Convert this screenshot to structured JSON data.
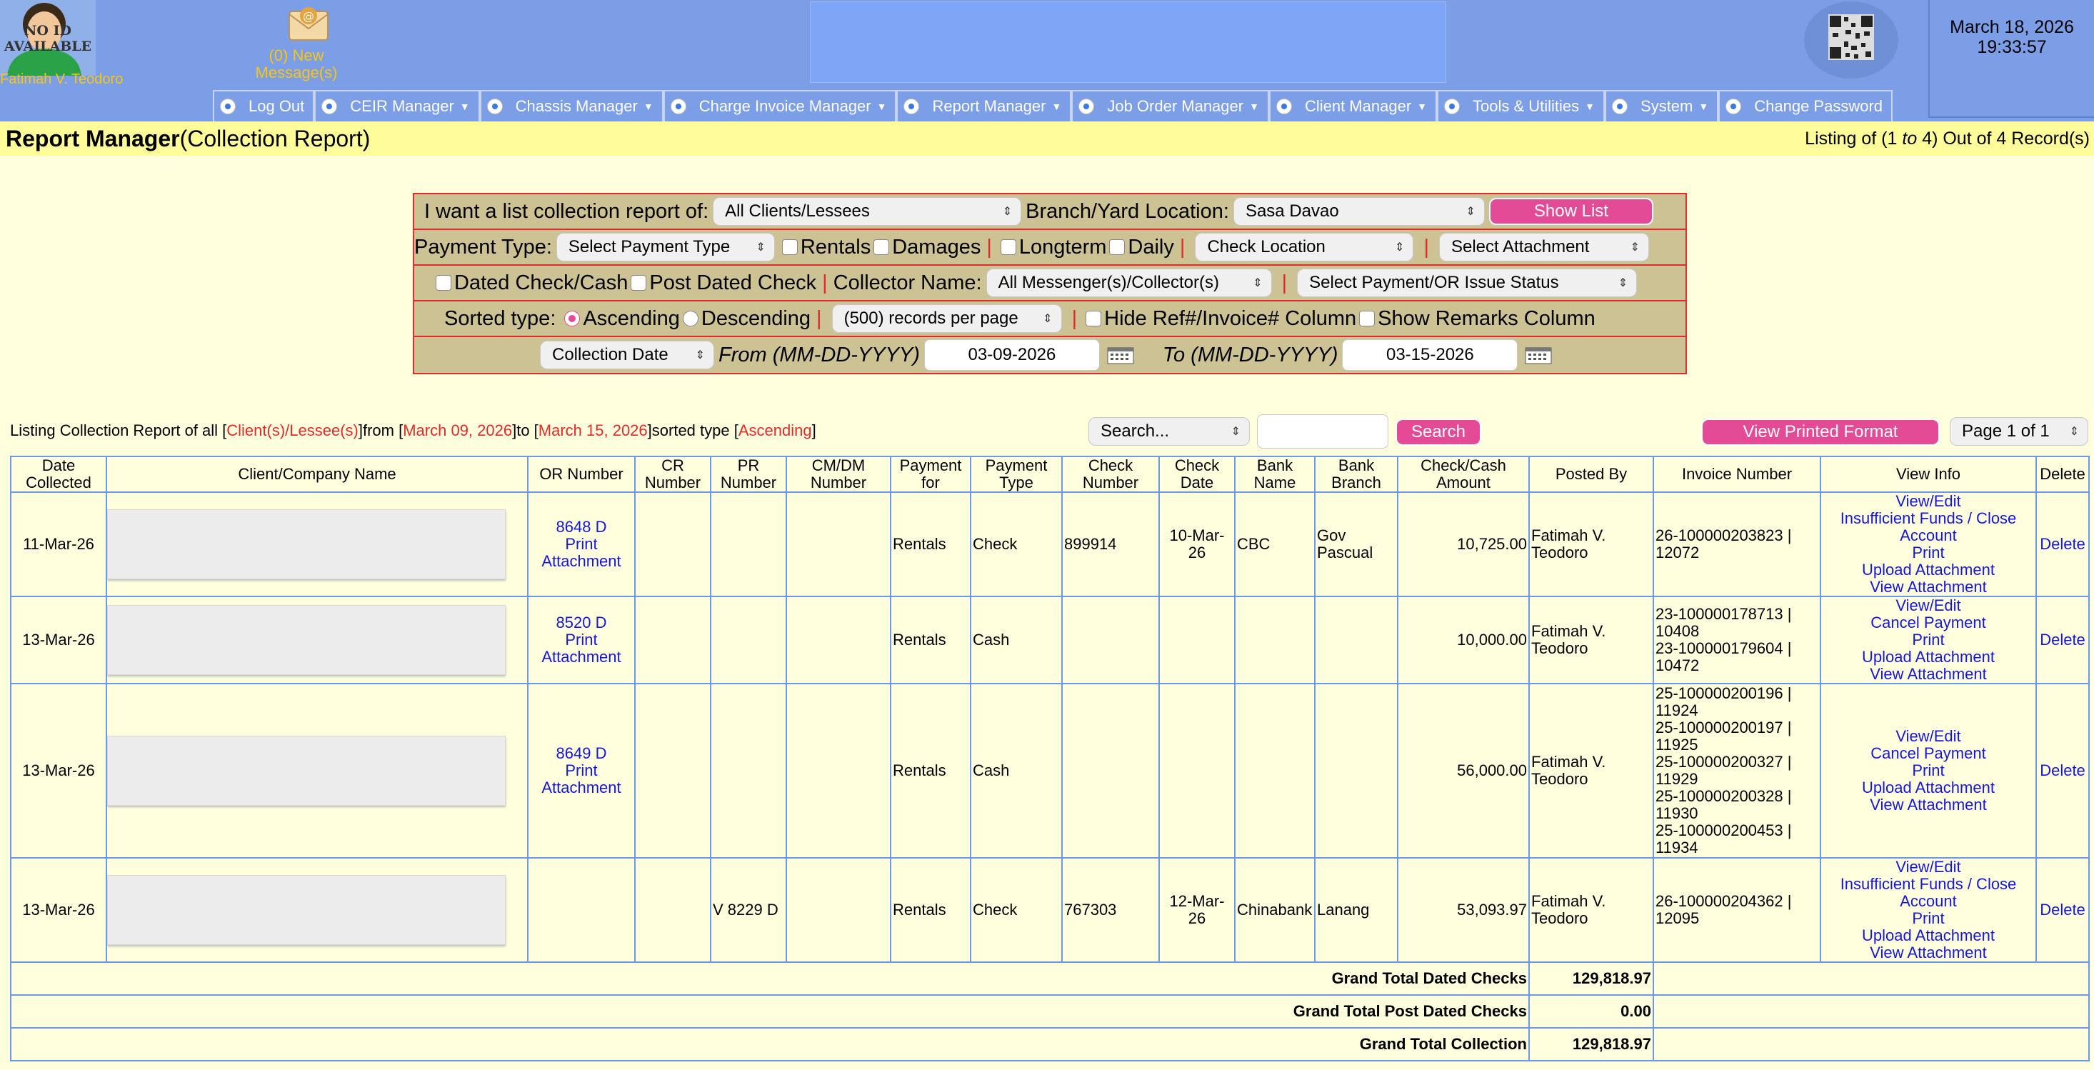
{
  "header": {
    "avatar_text": "NO ID AVAILABLE",
    "user_name": "Fatimah V. Teodoro",
    "messages_label": "(0) New Message(s)",
    "date": "March 18, 2026",
    "time": "19:33:57"
  },
  "menu": [
    {
      "label": "Log Out",
      "dropdown": false
    },
    {
      "label": "CEIR Manager",
      "dropdown": true
    },
    {
      "label": "Chassis Manager",
      "dropdown": true
    },
    {
      "label": "Charge Invoice Manager",
      "dropdown": true
    },
    {
      "label": "Report Manager",
      "dropdown": true
    },
    {
      "label": "Job Order Manager",
      "dropdown": true
    },
    {
      "label": "Client Manager",
      "dropdown": true
    },
    {
      "label": "Tools & Utilities",
      "dropdown": true
    },
    {
      "label": "System",
      "dropdown": true
    },
    {
      "label": "Change Password",
      "dropdown": false
    }
  ],
  "title": {
    "main": "Report Manager",
    "sub": "(Collection Report)",
    "listing_prefix": "Listing of (",
    "listing_from": "1",
    "listing_to_word": "to",
    "listing_to": "4",
    "listing_suffix": ") Out of 4 Record(s)"
  },
  "filters": {
    "list_label": "I want a list collection report of:",
    "client_select": "All Clients/Lessees",
    "branch_label": "Branch/Yard Location:",
    "branch_select": "Sasa Davao",
    "show_list": "Show List",
    "payment_type_label": "Payment Type:",
    "payment_type_select": "Select Payment Type",
    "rentals": "Rentals",
    "damages": "Damages",
    "longterm": "Longterm",
    "daily": "Daily",
    "check_location": "Check Location",
    "attachment": "Select Attachment",
    "dated_check": "Dated Check/Cash",
    "post_dated_check": "Post Dated Check",
    "collector_label": "Collector Name:",
    "collector_select": "All Messenger(s)/Collector(s)",
    "or_status_select": "Select Payment/OR Issue Status",
    "sorted_label": "Sorted type:",
    "ascending": "Ascending",
    "descending": "Descending",
    "records_per_page": "(500) records per page",
    "hide_ref": "Hide Ref#/Invoice# Column",
    "show_remarks": "Show Remarks Column",
    "date_field": "Collection Date",
    "from_label": "From (MM-DD-YYYY)",
    "from_value": "03-09-2026",
    "to_label": "To (MM-DD-YYYY)",
    "to_value": "03-15-2026"
  },
  "summary": {
    "prefix": "Listing Collection Report of all [",
    "clients": "Client(s)/Lessee(s)",
    "from_word": "]from [",
    "from_date": "March 09, 2026",
    "to_word": "]to [",
    "to_date": "March 15, 2026",
    "sorted_word": "]sorted type [",
    "sort": "Ascending",
    "end": "]"
  },
  "search": {
    "select": "Search...",
    "value": "",
    "button": "Search"
  },
  "printed_button": "View Printed Format",
  "page_select": "Page 1 of 1",
  "table": {
    "headers": {
      "date": "Date Collected",
      "client": "Client/Company Name",
      "or": "OR Number",
      "cr": "CR Number",
      "pr": "PR Number",
      "cmdm": "CM/DM Number",
      "payfor": "Payment for",
      "paytype": "Payment Type",
      "checkno": "Check Number",
      "checkdate": "Check Date",
      "bank": "Bank Name",
      "branch": "Bank Branch",
      "amount": "Check/Cash Amount",
      "posted": "Posted By",
      "invoice": "Invoice Number",
      "view": "View Info",
      "delete": "Delete"
    },
    "rows": [
      {
        "date": "11-Mar-26",
        "or": "8648 D",
        "or_print": "Print",
        "or_attach": "Attachment",
        "cr": "",
        "pr": "",
        "cmdm": "",
        "payfor": "Rentals",
        "paytype": "Check",
        "checkno": "899914",
        "checkdate": "10-Mar-26",
        "bank": "CBC",
        "branch": "Gov Pascual",
        "amount": "10,725.00",
        "posted": "Fatimah V. Teodoro",
        "invoices": [
          "26-100000203823 | 12072"
        ],
        "links": [
          "View/Edit",
          "Insufficient Funds / Close Account",
          "Print",
          "Upload Attachment",
          "View Attachment"
        ],
        "delete": "Delete"
      },
      {
        "date": "13-Mar-26",
        "or": "8520 D",
        "or_print": "Print",
        "or_attach": "Attachment",
        "cr": "",
        "pr": "",
        "cmdm": "",
        "payfor": "Rentals",
        "paytype": "Cash",
        "checkno": "",
        "checkdate": "",
        "bank": "",
        "branch": "",
        "amount": "10,000.00",
        "posted": "Fatimah V. Teodoro",
        "invoices": [
          "23-100000178713 | 10408",
          "23-100000179604 | 10472"
        ],
        "links": [
          "View/Edit",
          "Cancel Payment",
          "Print",
          "Upload Attachment",
          "View Attachment"
        ],
        "delete": "Delete"
      },
      {
        "date": "13-Mar-26",
        "or": "8649 D",
        "or_print": "Print",
        "or_attach": "Attachment",
        "cr": "",
        "pr": "",
        "cmdm": "",
        "payfor": "Rentals",
        "paytype": "Cash",
        "checkno": "",
        "checkdate": "",
        "bank": "",
        "branch": "",
        "amount": "56,000.00",
        "posted": "Fatimah V. Teodoro",
        "invoices": [
          "25-100000200196 | 11924",
          "25-100000200197 | 11925",
          "25-100000200327 | 11929",
          "25-100000200328 | 11930",
          "25-100000200453 | 11934"
        ],
        "links": [
          "View/Edit",
          "Cancel Payment",
          "Print",
          "Upload Attachment",
          "View Attachment"
        ],
        "delete": "Delete"
      },
      {
        "date": "13-Mar-26",
        "or": "",
        "or_print": "",
        "or_attach": "",
        "cr": "",
        "pr": "V 8229 D",
        "cmdm": "",
        "payfor": "Rentals",
        "paytype": "Check",
        "checkno": "767303",
        "checkdate": "12-Mar-26",
        "bank": "Chinabank",
        "branch": "Lanang",
        "amount": "53,093.97",
        "posted": "Fatimah V. Teodoro",
        "invoices": [
          "26-100000204362 | 12095"
        ],
        "links": [
          "View/Edit",
          "Insufficient Funds / Close Account",
          "Print",
          "Upload Attachment",
          "View Attachment"
        ],
        "delete": "Delete"
      }
    ],
    "totals": [
      {
        "label": "Grand Total Dated Checks",
        "value": "129,818.97"
      },
      {
        "label": "Grand Total Post Dated Checks",
        "value": "0.00"
      },
      {
        "label": "Grand Total Collection",
        "value": "129,818.97"
      }
    ]
  }
}
